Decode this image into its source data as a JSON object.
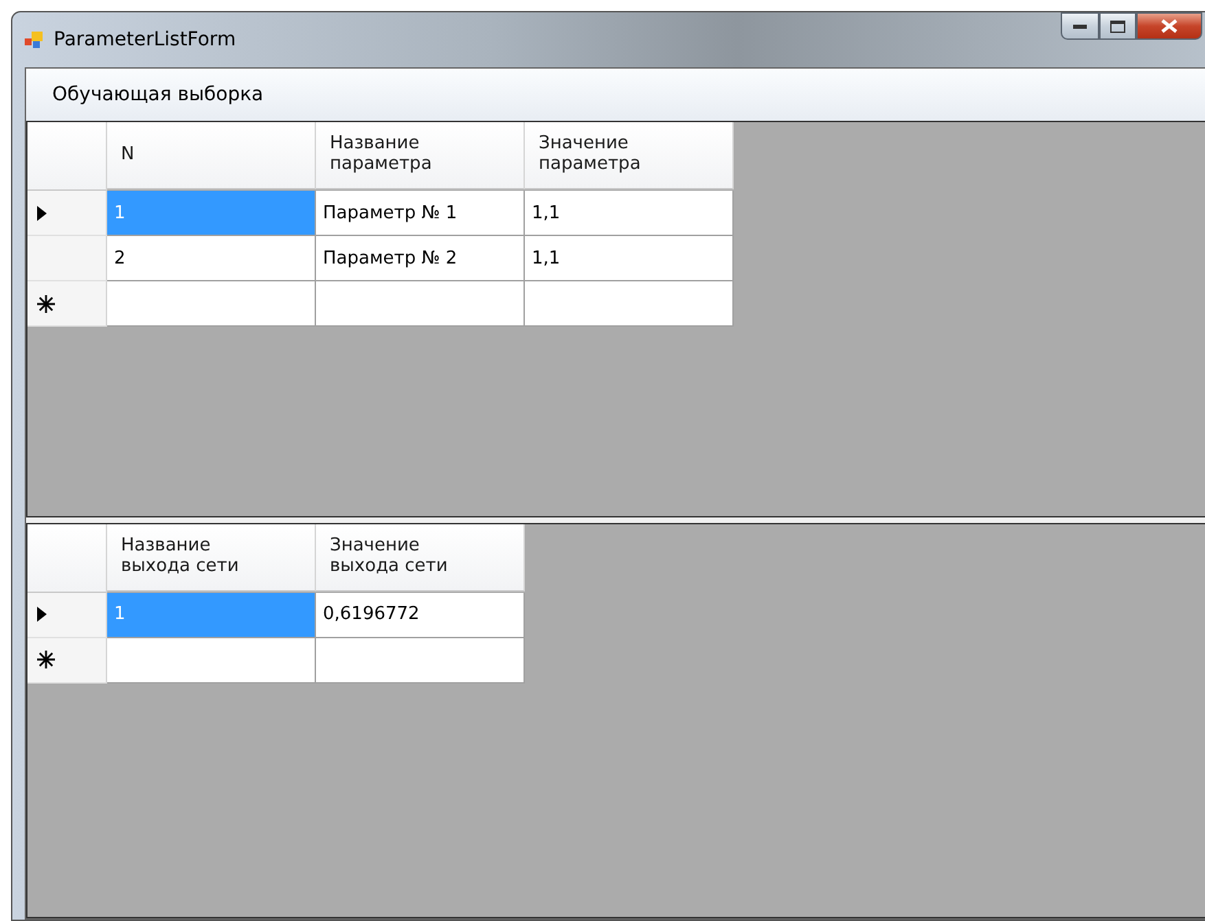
{
  "window": {
    "title": "ParameterListForm"
  },
  "menu": [
    "Обучающая выборка"
  ],
  "grids": [
    {
      "columns": [
        "N",
        "Название\nпараметра",
        "Значение\nпараметра"
      ],
      "rows": [
        {
          "kind": "current",
          "cells": [
            {
              "text": "1",
              "selected": true
            },
            {
              "text": "Параметр № 1",
              "selected": false
            },
            {
              "text": "1,1",
              "selected": false
            }
          ]
        },
        {
          "kind": "plain",
          "cells": [
            {
              "text": "2",
              "selected": false
            },
            {
              "text": "Параметр № 2",
              "selected": false
            },
            {
              "text": "1,1",
              "selected": false
            }
          ]
        },
        {
          "kind": "new"
        }
      ]
    },
    {
      "columns": [
        "Название\nвыхода сети",
        "Значение\nвыхода сети"
      ],
      "rows": [
        {
          "kind": "current",
          "cells": [
            {
              "text": "1",
              "selected": true
            },
            {
              "text": "0,6196772",
              "selected": false
            }
          ]
        },
        {
          "kind": "new"
        }
      ]
    }
  ]
}
